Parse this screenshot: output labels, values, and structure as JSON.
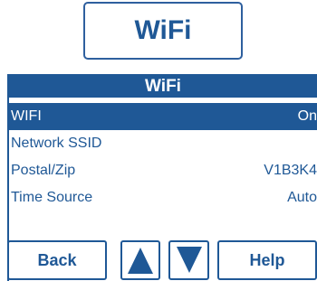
{
  "title_box": {
    "label": "WiFi"
  },
  "screen": {
    "header": "WiFi",
    "items": [
      {
        "label": "WIFI",
        "value": "On",
        "selected": true
      },
      {
        "label": "Network SSID",
        "value": ""
      },
      {
        "label": "Postal/Zip",
        "value": "V1B3K4"
      },
      {
        "label": "Time Source",
        "value": "Auto"
      }
    ]
  },
  "buttons": {
    "back": "Back",
    "up": "up-arrow-icon",
    "down": "down-arrow-icon",
    "help": "Help"
  },
  "colors": {
    "accent": "#1f5896",
    "background": "#ffffff",
    "selected_text": "#ffffff"
  }
}
